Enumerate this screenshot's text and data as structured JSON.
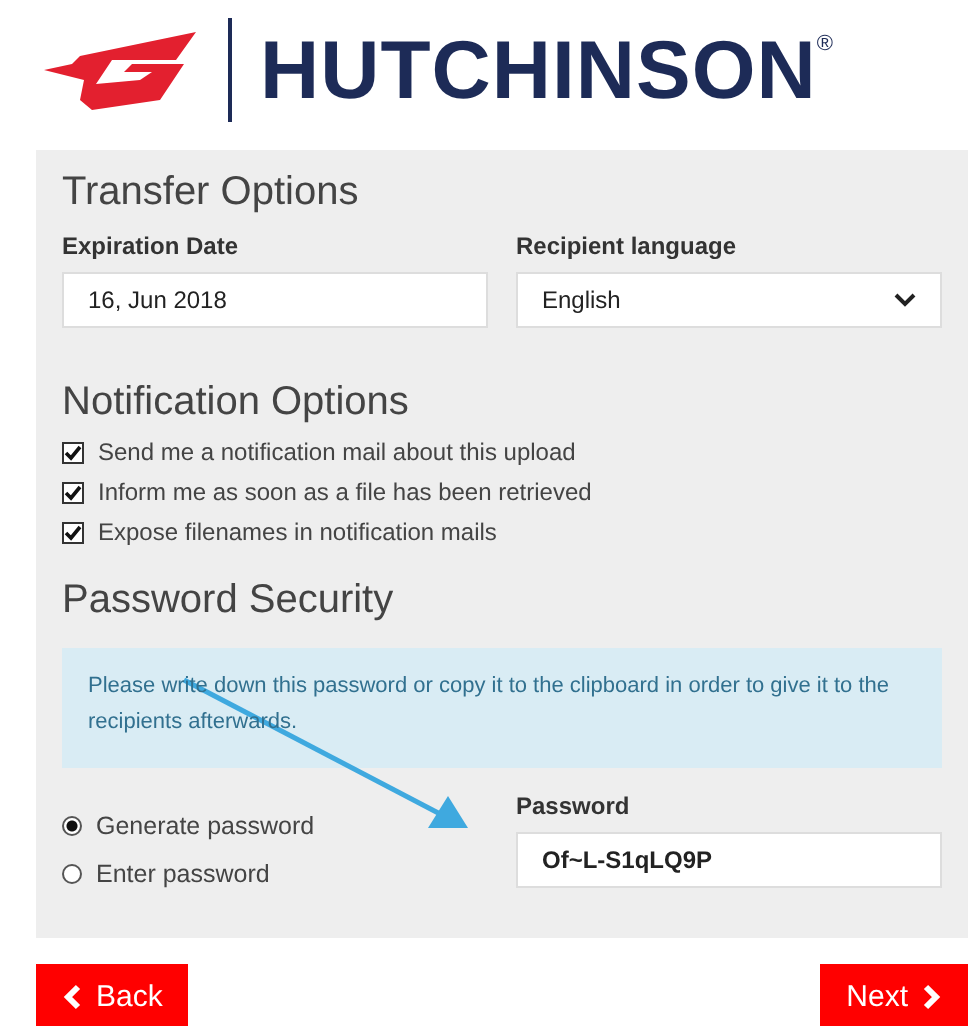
{
  "logo": {
    "wordmark": "HUTCHINSON",
    "registered": "®"
  },
  "transfer_options": {
    "title": "Transfer Options",
    "expiration_date": {
      "label": "Expiration Date",
      "value": "16, Jun 2018"
    },
    "recipient_language": {
      "label": "Recipient language",
      "value": "English"
    }
  },
  "notification_options": {
    "title": "Notification Options",
    "items": [
      {
        "label": "Send me a notification mail about this upload",
        "checked": true
      },
      {
        "label": "Inform me as soon as a file has been retrieved",
        "checked": true
      },
      {
        "label": "Expose filenames in notification mails",
        "checked": true
      }
    ]
  },
  "password_security": {
    "title": "Password Security",
    "info": "Please write down this password or copy it to the clipboard in order to give it to the recipients afterwards.",
    "options": [
      {
        "label": "Generate password",
        "selected": true
      },
      {
        "label": "Enter password",
        "selected": false
      }
    ],
    "password": {
      "label": "Password",
      "value": "Of~L-S1qLQ9P"
    }
  },
  "buttons": [
    {
      "label": "Back",
      "kind": "back"
    },
    {
      "label": "Next",
      "kind": "next"
    }
  ]
}
